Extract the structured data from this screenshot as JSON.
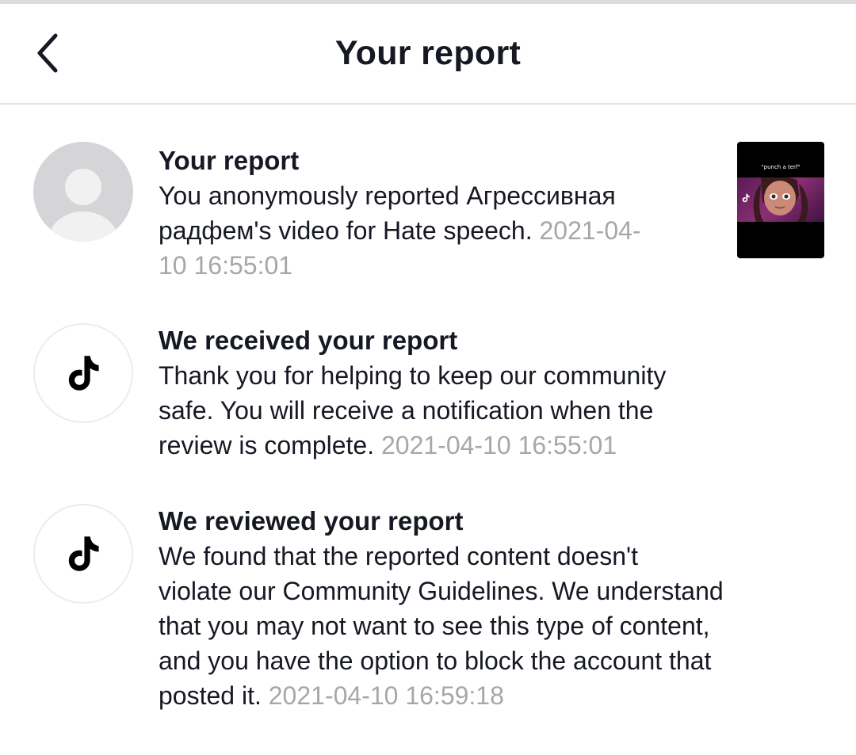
{
  "header": {
    "title": "Your report",
    "back_icon": "chevron-left-icon"
  },
  "items": [
    {
      "avatar": "default-user-avatar",
      "title": "Your report",
      "body_lines": [
        "You anonymously reported Агрессивная",
        "радфем's video for Hate speech. "
      ],
      "timestamp_lines": [
        "2021-04-",
        "10 16:55:01"
      ],
      "thumbnail": {
        "caption": "\"punch a terf\"",
        "icon": "video-thumbnail"
      }
    },
    {
      "avatar": "tiktok-logo-icon",
      "title": "We received your report",
      "body_lines": [
        "Thank you for helping to keep our community",
        "safe. You will receive a notification when the",
        "review is complete. "
      ],
      "timestamp": "2021-04-10 16:55:01"
    },
    {
      "avatar": "tiktok-logo-icon",
      "title": "We reviewed your report",
      "body_lines": [
        "We found that the reported content doesn't",
        "violate our Community Guidelines. We understand",
        "that you may not want to see this type of content,",
        "and you have the option to block the account that",
        "posted it. "
      ],
      "timestamp": "2021-04-10 16:59:18"
    }
  ],
  "colors": {
    "text": "#161823",
    "timestamp": "#a7a7ab",
    "divider": "#e3e3e6",
    "avatar_bg": "#d5d5d8"
  }
}
